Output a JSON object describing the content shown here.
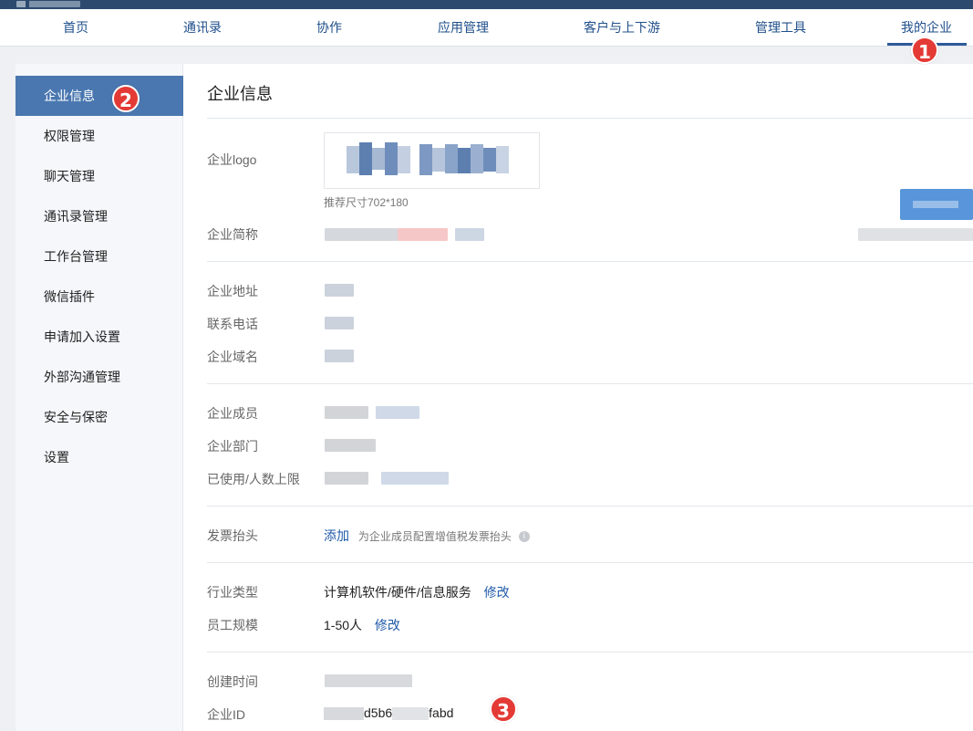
{
  "nav": {
    "items": [
      "首页",
      "通讯录",
      "协作",
      "应用管理",
      "客户与上下游",
      "管理工具",
      "我的企业"
    ],
    "active": "我的企业"
  },
  "badges": [
    "1",
    "2",
    "3"
  ],
  "sidebar": {
    "items": [
      "企业信息",
      "权限管理",
      "聊天管理",
      "通讯录管理",
      "工作台管理",
      "微信插件",
      "申请加入设置",
      "外部沟通管理",
      "安全与保密",
      "设置"
    ],
    "active": "企业信息"
  },
  "content": {
    "title": "企业信息",
    "logo": {
      "label": "企业logo",
      "hint": "推荐尺寸702*180"
    },
    "short_name": {
      "label": "企业简称"
    },
    "address": {
      "label": "企业地址"
    },
    "phone": {
      "label": "联系电话"
    },
    "domain": {
      "label": "企业域名"
    },
    "members": {
      "label": "企业成员"
    },
    "departments": {
      "label": "企业部门"
    },
    "usage": {
      "label": "已使用/人数上限"
    },
    "invoice": {
      "label": "发票抬头",
      "action": "添加",
      "hint": "为企业成员配置增值税发票抬头"
    },
    "industry": {
      "label": "行业类型",
      "value": "计算机软件/硬件/信息服务",
      "action": "修改"
    },
    "scale": {
      "label": "员工规模",
      "value": "1-50人",
      "action": "修改"
    },
    "created": {
      "label": "创建时间"
    },
    "corp_id": {
      "label": "企业ID",
      "value_part1": "d5b6",
      "value_part2": "fabd"
    }
  },
  "colors": {
    "topbar": "#2c4a6e",
    "accent": "#4a77b0",
    "link": "#1f5aa8",
    "badge": "#e43a35"
  }
}
